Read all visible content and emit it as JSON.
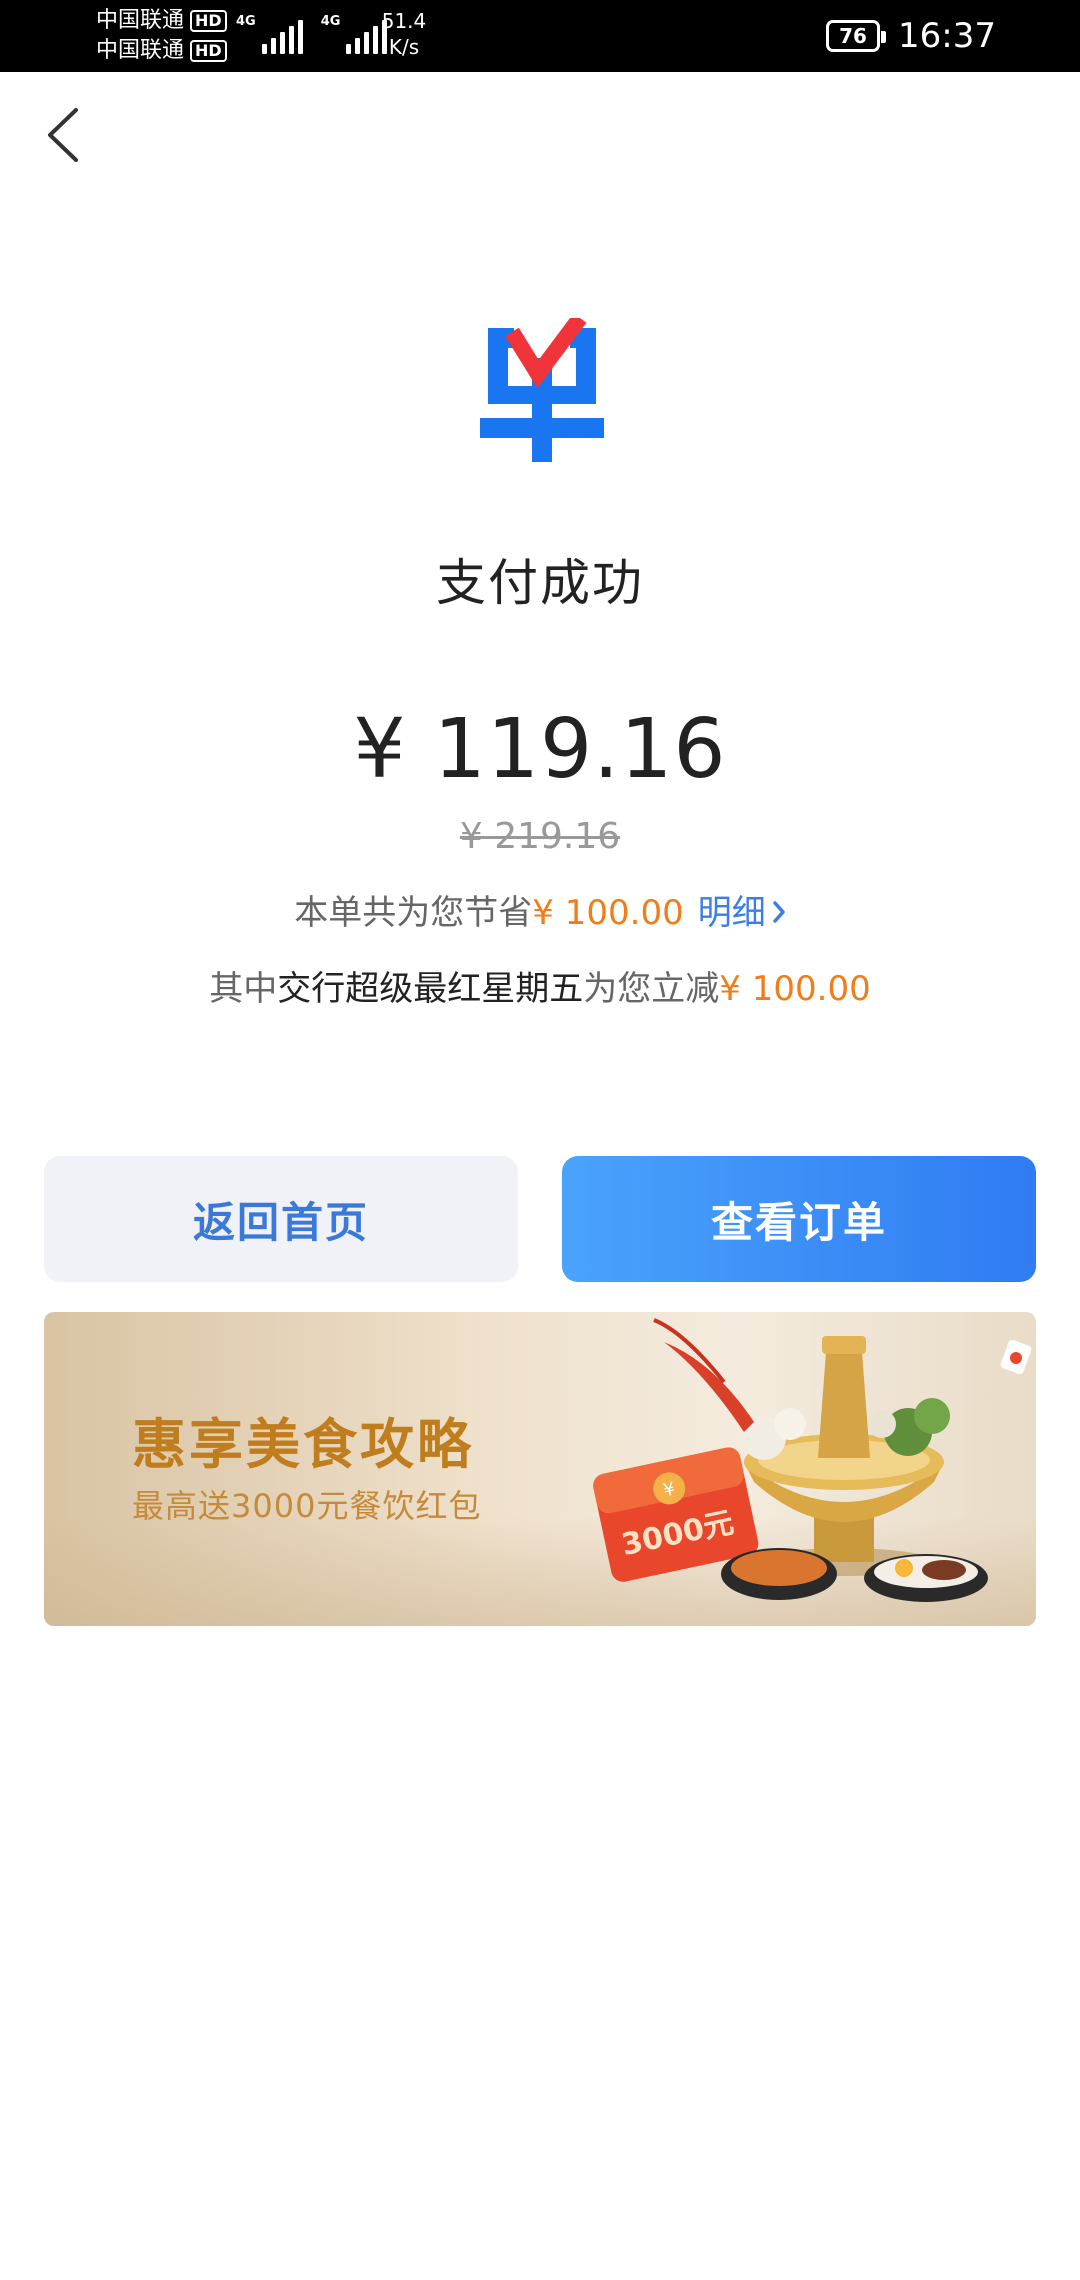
{
  "status_bar": {
    "carrier_1": "中国联通",
    "carrier_2": "中国联通",
    "hd_badge": "HD",
    "network_1": "4G",
    "network_2": "4G",
    "net_speed_value": "51.4",
    "net_speed_unit": "K/s",
    "battery": "76",
    "time": "16:37"
  },
  "header": {
    "back_icon": "chevron-left-icon"
  },
  "logo": {
    "icon": "order-logo-icon",
    "colors": {
      "blue": "#1976f0",
      "red": "#f0343a"
    }
  },
  "result": {
    "title": "支付成功",
    "amount": "¥ 119.16",
    "original_price": "¥ 219.16"
  },
  "savings": {
    "prefix": "本单共为您节省",
    "amount": "¥ 100.00",
    "detail_label": "明细"
  },
  "discount": {
    "prefix": "其中",
    "promo_name": "交行超级最红星期五",
    "middle": "为您立减",
    "amount": "¥ 100.00"
  },
  "actions": {
    "home_label": "返回首页",
    "order_label": "查看订单"
  },
  "banner": {
    "title": "惠享美食攻略",
    "subtitle": "最高送3000元餐饮红包",
    "coupon_text": "3000元"
  },
  "colors": {
    "accent_blue": "#2f7bf2",
    "savings_orange": "#f07d1a",
    "banner_gold": "#c07d1e"
  }
}
